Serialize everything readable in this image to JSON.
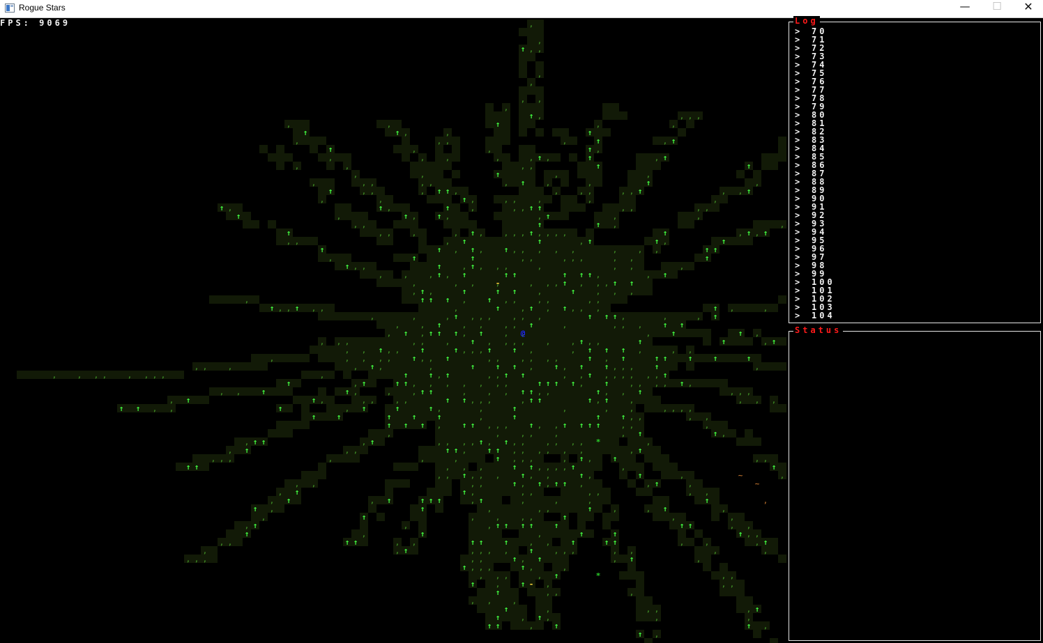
{
  "window": {
    "title": "Rogue Stars",
    "minimize_glyph": "—",
    "maximize_glyph": "☐",
    "close_glyph": "✕"
  },
  "hud": {
    "fps_label": "FPS:",
    "fps_value": "9069"
  },
  "log": {
    "title": "Log",
    "prompt": ">",
    "entries": [
      "70",
      "71",
      "72",
      "73",
      "74",
      "75",
      "76",
      "77",
      "78",
      "79",
      "80",
      "81",
      "82",
      "83",
      "84",
      "85",
      "86",
      "87",
      "88",
      "89",
      "90",
      "91",
      "92",
      "93",
      "94",
      "95",
      "96",
      "97",
      "98",
      "99",
      "100",
      "101",
      "102",
      "103",
      "104"
    ]
  },
  "status": {
    "title": "Status"
  },
  "map": {
    "player_glyph": "@",
    "tree_glyph": "↑",
    "grass_glyph": ",",
    "star_glyph": "*",
    "water_glyph": "~",
    "item_glyph": "-",
    "colors": {
      "background": "#000000",
      "floor": "#121a07",
      "grass": "#3f8f26",
      "tree": "#43ff43",
      "player": "#1c25ff",
      "star": "#2bd12b",
      "water": "#b06a2a",
      "item": "#ffd83c",
      "log_text": "#f2f2f2",
      "panel_title": "#ff1a1a"
    }
  }
}
